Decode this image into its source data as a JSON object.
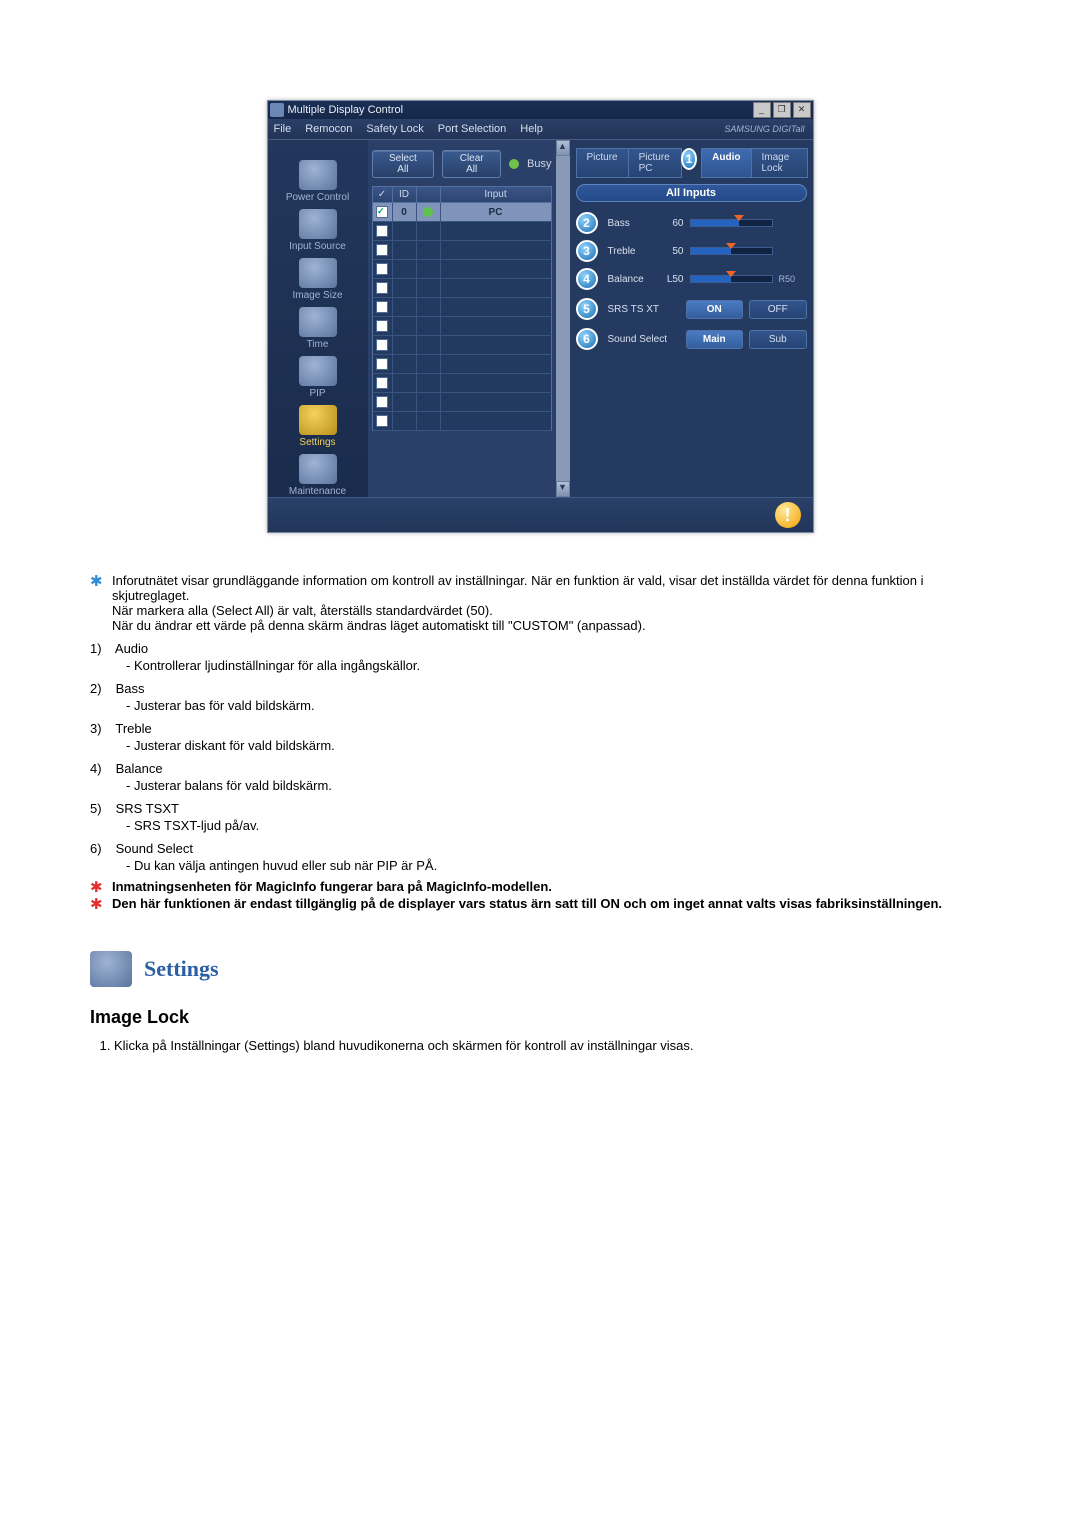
{
  "window": {
    "title": "Multiple Display Control",
    "minimize_glyph": "_",
    "restore_glyph": "❐",
    "close_glyph": "✕"
  },
  "menu": {
    "items": [
      "File",
      "Remocon",
      "Safety Lock",
      "Port Selection",
      "Help"
    ],
    "brand": "SAMSUNG DIGITall"
  },
  "sidebar": {
    "items": [
      {
        "label": "Power Control"
      },
      {
        "label": "Input Source"
      },
      {
        "label": "Image Size"
      },
      {
        "label": "Time"
      },
      {
        "label": "PIP"
      },
      {
        "label": "Settings"
      },
      {
        "label": "Maintenance"
      }
    ]
  },
  "toolbar": {
    "select_all": "Select All",
    "clear_all": "Clear All",
    "busy": "Busy"
  },
  "grid": {
    "headers": {
      "chk": "✓",
      "id": "ID",
      "status": " ",
      "input": "Input"
    },
    "row0_id": "0",
    "row0_input": "PC"
  },
  "tabs": {
    "picture": "Picture",
    "picture_pc": "Picture PC",
    "audio": "Audio",
    "image_lock": "Image Lock",
    "active_badge": "1"
  },
  "banner": "All Inputs",
  "sliders": {
    "bass": {
      "num": "2",
      "label": "Bass",
      "val": "60",
      "pct": 60
    },
    "treble": {
      "num": "3",
      "label": "Treble",
      "val": "50",
      "pct": 50
    },
    "balance": {
      "num": "4",
      "label": "Balance",
      "val": "L50",
      "pct": 50,
      "rlabel": "R50"
    }
  },
  "toggles": {
    "srs": {
      "num": "5",
      "label": "SRS TS XT",
      "a": "ON",
      "b": "OFF"
    },
    "sound": {
      "num": "6",
      "label": "Sound Select",
      "a": "Main",
      "b": "Sub"
    }
  },
  "status_glyph": "!",
  "text": {
    "star1": "Inforutnätet visar grundläggande information om kontroll av inställningar. När en funktion är vald, visar det inställda värdet för denna funktion i skjutreglaget.",
    "star1b": "När markera alla (Select All) är valt, återställs standardvärdet (50).",
    "star1c": "När du ändrar ett värde på denna skärm ändras läget automatiskt till \"CUSTOM\" (anpassad).",
    "items": [
      {
        "num": "1)",
        "title": "Audio",
        "desc": "- Kontrollerar ljudinställningar för alla ingångskällor."
      },
      {
        "num": "2)",
        "title": "Bass",
        "desc": "- Justerar bas för vald bildskärm."
      },
      {
        "num": "3)",
        "title": "Treble",
        "desc": "- Justerar diskant för vald bildskärm."
      },
      {
        "num": "4)",
        "title": "Balance",
        "desc": "- Justerar balans för vald bildskärm."
      },
      {
        "num": "5)",
        "title": "SRS TSXT",
        "desc": "- SRS TSXT-ljud på/av."
      },
      {
        "num": "6)",
        "title": "Sound Select",
        "desc": "- Du kan välja antingen huvud eller sub när PIP är PÅ."
      }
    ],
    "redstar1": "Inmatningsenheten för MagicInfo fungerar bara på MagicInfo-modellen.",
    "redstar2": "Den här funktionen är endast tillgänglig på de displayer vars status ärn satt till ON och om inget annat valts visas fabriksinställningen.",
    "settings_heading": "Settings",
    "image_lock_heading": "Image Lock",
    "ol_item": "Klicka på Inställningar (Settings) bland huvudikonerna och skärmen för kontroll av inställningar visas."
  }
}
